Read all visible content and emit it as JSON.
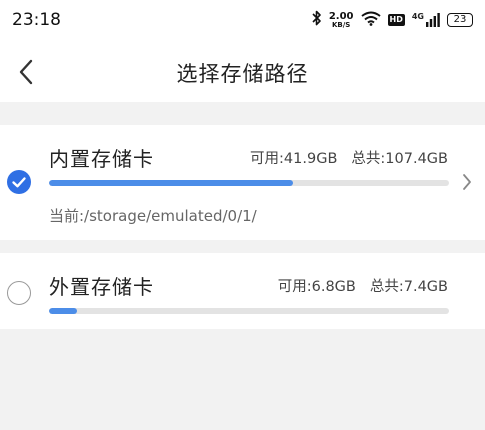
{
  "status_bar": {
    "time": "23:18",
    "net_speed_value": "2.00",
    "net_speed_unit": "KB/S",
    "hd_label": "HD",
    "signal_label": "4G",
    "battery": "23"
  },
  "header": {
    "title": "选择存储路径",
    "back_icon": "chevron-left-icon"
  },
  "storage": [
    {
      "name": "内置存储卡",
      "available": "可用:41.9GB",
      "total": "总共:107.4GB",
      "used_fraction": 0.61,
      "current_path": "当前:/storage/emulated/0/1/",
      "selected": true
    },
    {
      "name": "外置存储卡",
      "available": "可用:6.8GB",
      "total": "总共:7.4GB",
      "used_fraction": 0.07,
      "selected": false
    }
  ],
  "colors": {
    "accent": "#2f6fe4",
    "bar_fill": "#4c8de8",
    "bar_track": "#e3e3e3",
    "page_bg": "#f2f2f2"
  }
}
